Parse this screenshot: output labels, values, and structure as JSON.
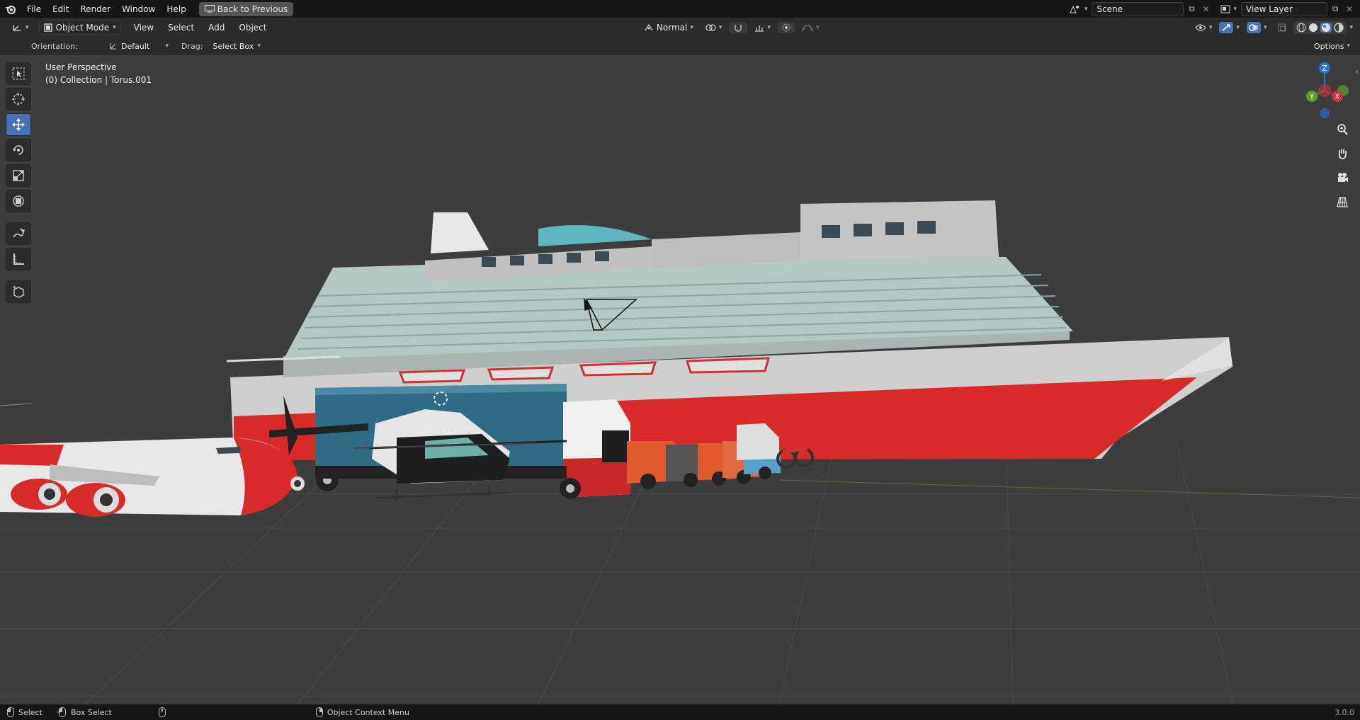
{
  "topbar": {
    "menus": [
      "File",
      "Edit",
      "Render",
      "Window",
      "Help"
    ],
    "back_button": "Back to Previous",
    "scene": "Scene",
    "view_layer": "View Layer"
  },
  "header": {
    "mode": "Object Mode",
    "menus": [
      "View",
      "Select",
      "Add",
      "Object"
    ],
    "transform_orientation": "Normal"
  },
  "toolsettings": {
    "orientation_label": "Orientation:",
    "orientation_value": "Default",
    "drag_label": "Drag:",
    "drag_value": "Select Box",
    "options": "Options"
  },
  "overlay": {
    "view_name": "User Perspective",
    "collection": "(0) Collection | Torus.001"
  },
  "gizmo": {
    "z": "Z",
    "y": "Y",
    "x": "X"
  },
  "statusbar": {
    "select": "Select",
    "box_select": "Box Select",
    "context_menu": "Object Context Menu",
    "version": "3.0.0"
  },
  "colors": {
    "viewport_bg": "#3d3d3d",
    "accent": "#4772b3",
    "ship_red": "#d92a2a"
  }
}
